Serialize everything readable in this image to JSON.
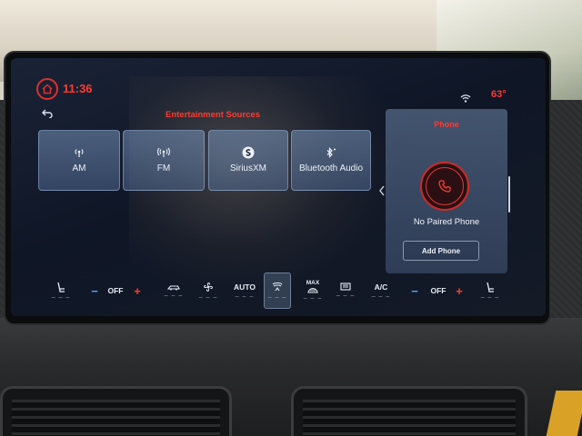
{
  "status_bar": {
    "clock": "11:36",
    "temperature": "63°",
    "section_title": "Entertainment Sources"
  },
  "icons": {
    "home": "home-icon",
    "back": "back-arrow-icon",
    "wifi": "wifi-icon"
  },
  "sources": [
    {
      "label": "AM",
      "icon": "am-radio-icon"
    },
    {
      "label": "FM",
      "icon": "fm-radio-icon"
    },
    {
      "label": "SiriusXM",
      "icon": "siriusxm-icon"
    },
    {
      "label": "Bluetooth Audio",
      "icon": "bluetooth-icon"
    }
  ],
  "phone": {
    "title": "Phone",
    "status": "No Paired Phone",
    "add_button": "Add Phone"
  },
  "climate": {
    "left_temp_minus": "−",
    "left_temp": "OFF",
    "left_temp_plus": "+",
    "auto": "AUTO",
    "max": "MAX",
    "ac": "A/C",
    "right_temp_minus": "−",
    "right_temp": "OFF",
    "right_temp_plus": "+",
    "level_marks": "– – –"
  },
  "colors": {
    "accent_red": "#ff3b30",
    "minus_blue": "#4ea3ff"
  }
}
